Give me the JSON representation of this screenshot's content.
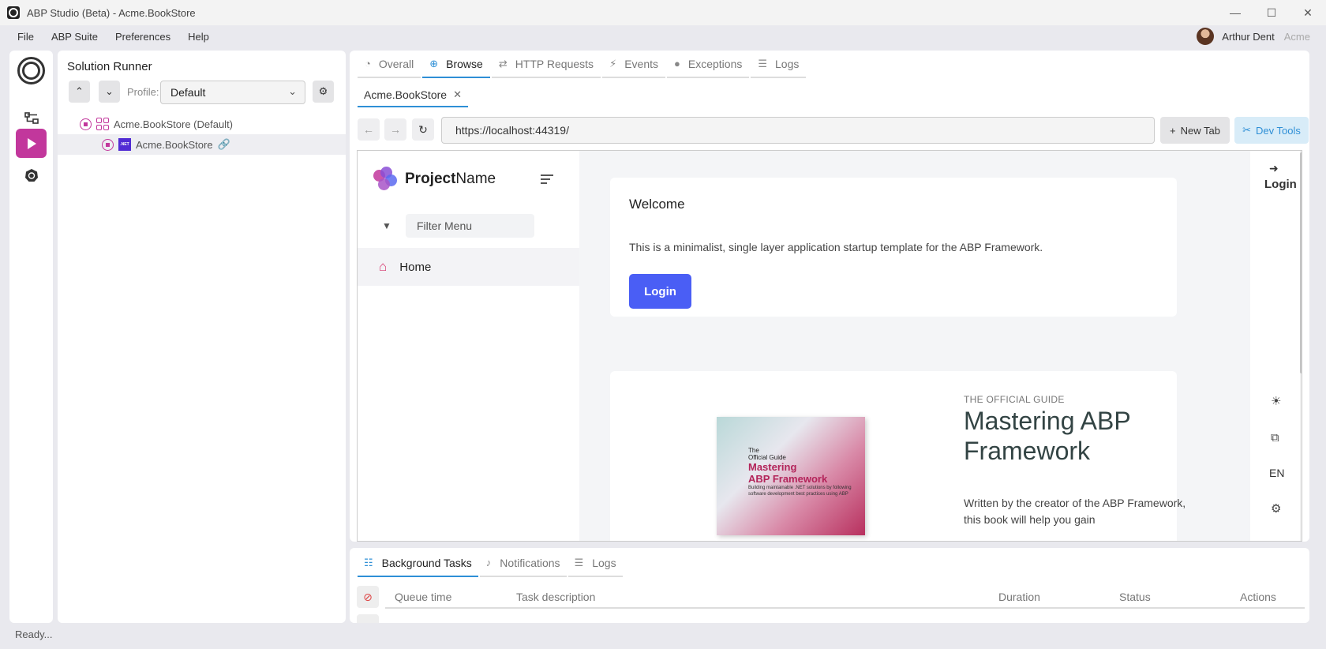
{
  "window": {
    "title": "ABP Studio (Beta) - Acme.BookStore",
    "controls": [
      "—",
      "☐",
      "✕"
    ]
  },
  "menu": {
    "items": [
      "File",
      "ABP Suite",
      "Preferences",
      "Help"
    ],
    "user_name": "Arthur Dent",
    "user_org": "Acme"
  },
  "runner": {
    "title": "Solution Runner",
    "profile_label": "Profile:",
    "profile_value": "Default",
    "tree": [
      {
        "label": "Acme.BookStore (Default)"
      },
      {
        "label": "Acme.BookStore"
      }
    ]
  },
  "main": {
    "tabs": [
      {
        "label": "Overall",
        "icon": "gauge-icon"
      },
      {
        "label": "Browse",
        "icon": "globe-icon"
      },
      {
        "label": "HTTP Requests",
        "icon": "arrows-icon"
      },
      {
        "label": "Events",
        "icon": "bolt-icon"
      },
      {
        "label": "Exceptions",
        "icon": "alert-icon"
      },
      {
        "label": "Logs",
        "icon": "list-icon"
      }
    ],
    "active_tab": "Browse",
    "browser_tab": "Acme.BookStore",
    "url": "https://localhost:44319/",
    "new_tab": "New Tab",
    "dev_tools": "Dev Tools"
  },
  "webpage": {
    "brand_bold": "Project",
    "brand_rest": "Name",
    "filter_placeholder": "Filter Menu",
    "menu_home": "Home",
    "welcome_title": "Welcome",
    "welcome_text": "This is a minimalist, single layer application startup template for the ABP Framework.",
    "login_button": "Login",
    "book": {
      "line1": "The",
      "line2": "Official Guide",
      "big1": "Mastering",
      "big2": "ABP Framework",
      "small": "Building maintainable .NET solutions by following software development best practices using ABP"
    },
    "guide_kicker": "THE OFFICIAL GUIDE",
    "guide_title": "Mastering ABP Framework",
    "guide_text": "Written by the creator of the ABP Framework, this book will help you gain",
    "side_login": "Login",
    "lang": "EN"
  },
  "bottom": {
    "tabs": [
      {
        "label": "Background Tasks",
        "icon": "tasks-icon"
      },
      {
        "label": "Notifications",
        "icon": "bell-icon"
      },
      {
        "label": "Logs",
        "icon": "list-icon"
      }
    ],
    "columns": [
      "Queue time",
      "Task description",
      "Duration",
      "Status",
      "Actions"
    ]
  },
  "status_text": "Ready..."
}
